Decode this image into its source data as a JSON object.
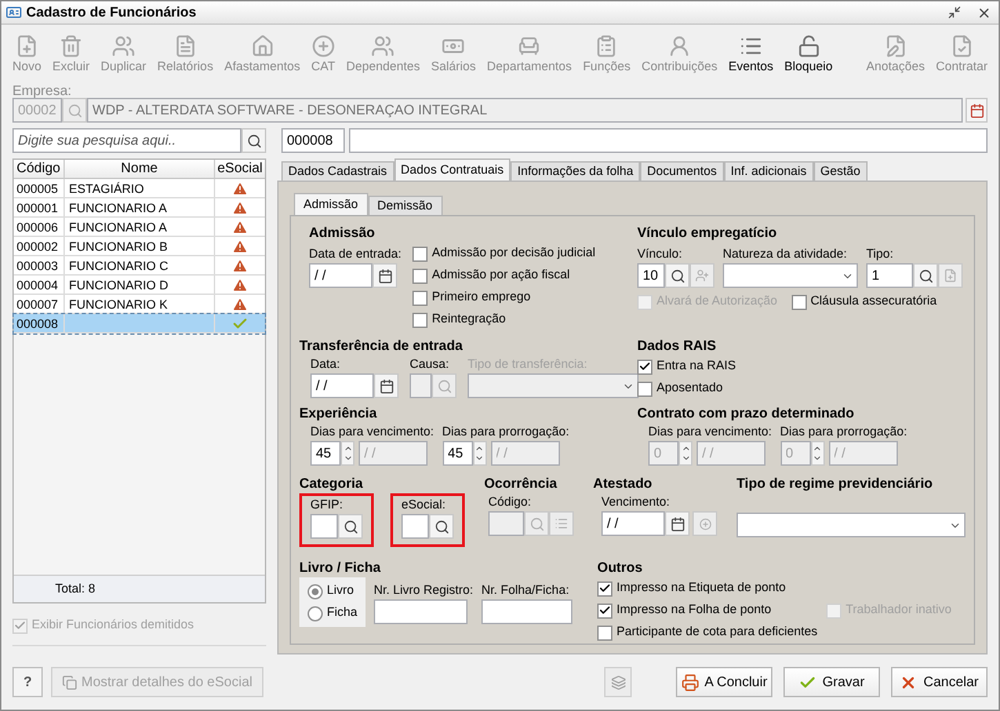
{
  "window": {
    "title": "Cadastro de Funcionários"
  },
  "toolbar": [
    {
      "label": "Novo",
      "disabled": true
    },
    {
      "label": "Excluir",
      "disabled": true
    },
    {
      "label": "Duplicar",
      "disabled": true
    },
    {
      "label": "Relatórios",
      "disabled": true
    },
    {
      "label": "Afastamentos",
      "disabled": true
    },
    {
      "label": "CAT",
      "disabled": true
    },
    {
      "label": "Dependentes",
      "disabled": true
    },
    {
      "label": "Salários",
      "disabled": true
    },
    {
      "label": "Departamentos",
      "disabled": true
    },
    {
      "label": "Funções",
      "disabled": true
    },
    {
      "label": "Contribuições",
      "disabled": true
    },
    {
      "label": "Eventos",
      "disabled": false
    },
    {
      "label": "Bloqueio",
      "disabled": false
    }
  ],
  "toolbar_right": [
    {
      "label": "Anotações",
      "disabled": true
    },
    {
      "label": "Contratar",
      "disabled": true
    }
  ],
  "empresa": {
    "label": "Empresa:",
    "code": "00002",
    "name": "WDP - ALTERDATA SOFTWARE - DESONERAÇAO INTEGRAL"
  },
  "search": {
    "placeholder": "Digite sua pesquisa aqui.."
  },
  "code_field": {
    "value": "000008"
  },
  "table": {
    "columns": [
      "Código",
      "Nome",
      "eSocial"
    ],
    "rows": [
      {
        "codigo": "000005",
        "nome": "ESTAGIÁRIO",
        "kind": "warning",
        "selected": false
      },
      {
        "codigo": "000001",
        "nome": "FUNCIONARIO A",
        "kind": "warning",
        "selected": false
      },
      {
        "codigo": "000006",
        "nome": "FUNCIONARIO A",
        "kind": "warning",
        "selected": false
      },
      {
        "codigo": "000002",
        "nome": "FUNCIONARIO B",
        "kind": "warning",
        "selected": false
      },
      {
        "codigo": "000003",
        "nome": "FUNCIONARIO C",
        "kind": "warning",
        "selected": false
      },
      {
        "codigo": "000004",
        "nome": "FUNCIONARIO D",
        "kind": "warning",
        "selected": false
      },
      {
        "codigo": "000007",
        "nome": "FUNCIONARIO K",
        "kind": "warning",
        "selected": false
      },
      {
        "codigo": "000008",
        "nome": "",
        "kind": "ok",
        "selected": true
      }
    ],
    "total": "Total: 8"
  },
  "show_dismissed": {
    "label": "Exibir Funcionários demitidos",
    "checked": true,
    "disabled": true
  },
  "tabs": [
    {
      "label": "Dados Cadastrais",
      "selected": false
    },
    {
      "label": "Dados Contratuais",
      "selected": true
    },
    {
      "label": "Informações da folha",
      "selected": false
    },
    {
      "label": "Documentos",
      "selected": false
    },
    {
      "label": "Inf. adicionais",
      "selected": false
    },
    {
      "label": "Gestão",
      "selected": false
    }
  ],
  "sub_tabs": [
    {
      "label": "Admissão",
      "selected": true
    },
    {
      "label": "Demissão",
      "selected": false
    }
  ],
  "admissao": {
    "title": "Admissão",
    "date": {
      "label": "Data de entrada:",
      "value": "/ /"
    },
    "options": [
      {
        "label": "Admissão por decisão judicial",
        "checked": false,
        "disabled": false
      },
      {
        "label": "Admissão por ação fiscal",
        "checked": false,
        "disabled": false
      },
      {
        "label": "Primeiro emprego",
        "checked": false,
        "disabled": false
      },
      {
        "label": "Reintegração",
        "checked": false,
        "disabled": false
      }
    ]
  },
  "transferencia": {
    "title": "Transferência de entrada",
    "data": {
      "label": "Data:",
      "value": "/ /"
    },
    "causa": {
      "label": "Causa:",
      "disabled": true
    },
    "tipo": {
      "label": "Tipo de transferência:",
      "disabled": true
    }
  },
  "vinculo": {
    "title": "Vínculo empregatício",
    "vinculo": {
      "label": "Vínculo:",
      "value": "10"
    },
    "natureza": {
      "label": "Natureza da atividade:"
    },
    "tipo": {
      "label": "Tipo:",
      "value": "1"
    },
    "options": [
      {
        "label": "Alvará de Autorização",
        "checked": false,
        "disabled": true
      },
      {
        "label": "Cláusula assecuratória",
        "checked": false,
        "disabled": false
      }
    ]
  },
  "rais": {
    "title": "Dados RAIS",
    "options": [
      {
        "label": "Entra na RAIS",
        "checked": true,
        "disabled": false
      },
      {
        "label": "Aposentado",
        "checked": false,
        "disabled": false
      }
    ]
  },
  "experiencia": {
    "title": "Experiência",
    "fields": [
      {
        "label": "Dias para vencimento:",
        "value": "45",
        "date": "/ /",
        "disabled": false
      },
      {
        "label": "Dias para prorrogação:",
        "value": "45",
        "date": "/ /",
        "disabled": false
      }
    ]
  },
  "contrato": {
    "title": "Contrato com prazo determinado",
    "fields": [
      {
        "label": "Dias para vencimento:",
        "value": "0",
        "date": "/ /",
        "disabled": true
      },
      {
        "label": "Dias para prorrogação:",
        "value": "0",
        "date": "/ /",
        "disabled": true
      }
    ]
  },
  "categoria": {
    "title": "Categoria",
    "fields": [
      {
        "label": "GFIP:",
        "highlighted": true
      },
      {
        "label": "eSocial:",
        "highlighted": true
      }
    ]
  },
  "ocorrencia": {
    "title": "Ocorrência",
    "codigo": {
      "label": "Código:",
      "disabled": true
    }
  },
  "atestado": {
    "title": "Atestado",
    "vencimento": {
      "label": "Vencimento:",
      "value": "/ /"
    }
  },
  "regime": {
    "title": "Tipo de regime previdenciário"
  },
  "livro_ficha": {
    "title": "Livro / Ficha",
    "options": [
      {
        "label": "Livro",
        "selected": true
      },
      {
        "label": "Ficha",
        "selected": false
      }
    ],
    "livro_registro": {
      "label": "Nr. Livro Registro:"
    },
    "folha": {
      "label": "Nr. Folha/Ficha:"
    }
  },
  "outros": {
    "title": "Outros",
    "rows": [
      [
        {
          "label": "Impresso na Etiqueta de ponto",
          "checked": true,
          "disabled": false
        }
      ],
      [
        {
          "label": "Impresso na Folha de ponto",
          "checked": true,
          "disabled": false
        },
        {
          "label": "Trabalhador inativo",
          "checked": false,
          "disabled": true
        }
      ],
      [
        {
          "label": "Participante de cota para deficientes",
          "checked": false,
          "disabled": false
        }
      ]
    ]
  },
  "footer": {
    "help": "?",
    "esocial_button": {
      "label": "Mostrar detalhes do eSocial",
      "disabled": true
    },
    "buttons": [
      {
        "label": "A Concluir",
        "kind": "pending"
      },
      {
        "label": "Gravar",
        "kind": "save"
      },
      {
        "label": "Cancelar",
        "kind": "cancel"
      }
    ]
  }
}
